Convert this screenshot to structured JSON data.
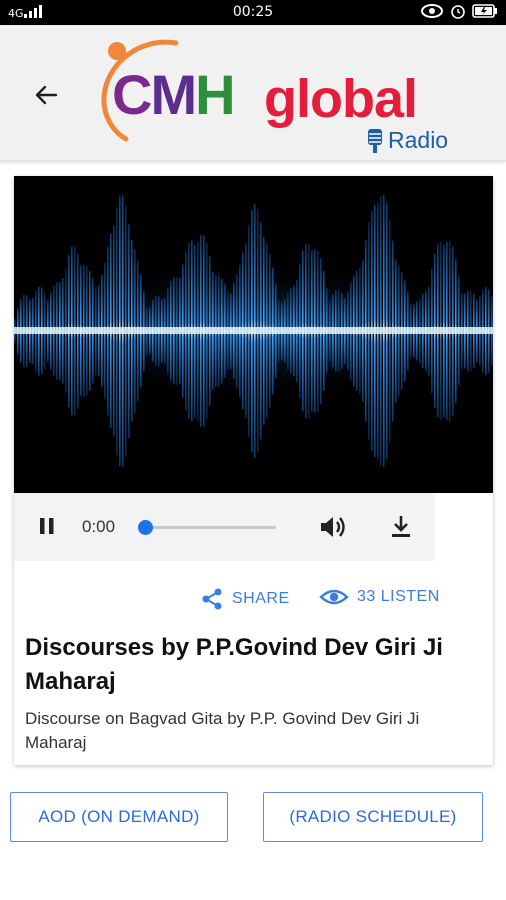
{
  "status_bar": {
    "time": "00:25"
  },
  "header": {
    "logo_cmh": [
      "C",
      "M",
      "H"
    ],
    "logo_global": "global",
    "logo_radio": "Radio"
  },
  "player": {
    "current_time": "0:00",
    "progress": 0.0
  },
  "actions": {
    "share_label": "SHARE",
    "listen_label": "33 LISTEN"
  },
  "program": {
    "title": "Discourses by P.P.Govind Dev Giri Ji Maharaj",
    "description": "Discourse on Bagvad Gita by P.P. Govind Dev Giri Ji Maharaj"
  },
  "buttons": {
    "aod": "AOD (ON DEMAND)",
    "schedule": "(RADIO SCHEDULE)"
  },
  "colors": {
    "accent": "#3a7de0",
    "player_thumb": "#1a73e8",
    "logo_red": "#e51d3c",
    "logo_blue": "#1b5fa6"
  }
}
